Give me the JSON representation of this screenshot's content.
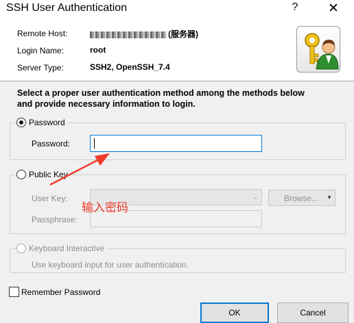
{
  "window": {
    "title": "SSH User Authentication",
    "help": "?",
    "close": "✕"
  },
  "header": {
    "remote_host_label": "Remote Host:",
    "remote_host_suffix": "(服务器)",
    "login_name_label": "Login Name:",
    "login_name": "root",
    "server_type_label": "Server Type:",
    "server_type": "SSH2, OpenSSH_7.4",
    "icon": "key-user-icon"
  },
  "instructions": "Select a proper user authentication method among the methods below\nand provide necessary information to login.",
  "password_group": {
    "label": "Password",
    "field_label": "Password:",
    "value": "",
    "selected": true
  },
  "public_key_group": {
    "label": "Public Key",
    "user_key_label": "User Key:",
    "user_key_value": "",
    "browse_label": "Browse...",
    "passphrase_label": "Passphrase:",
    "passphrase_value": ""
  },
  "keyboard_group": {
    "label": "Keyboard Interactive",
    "description": "Use keyboard input for user authentication."
  },
  "remember_password": {
    "label": "Remember Password",
    "checked": false
  },
  "buttons": {
    "ok": "OK",
    "cancel": "Cancel"
  },
  "annotation": {
    "text": "输入密码",
    "color": "#f03a2a"
  }
}
